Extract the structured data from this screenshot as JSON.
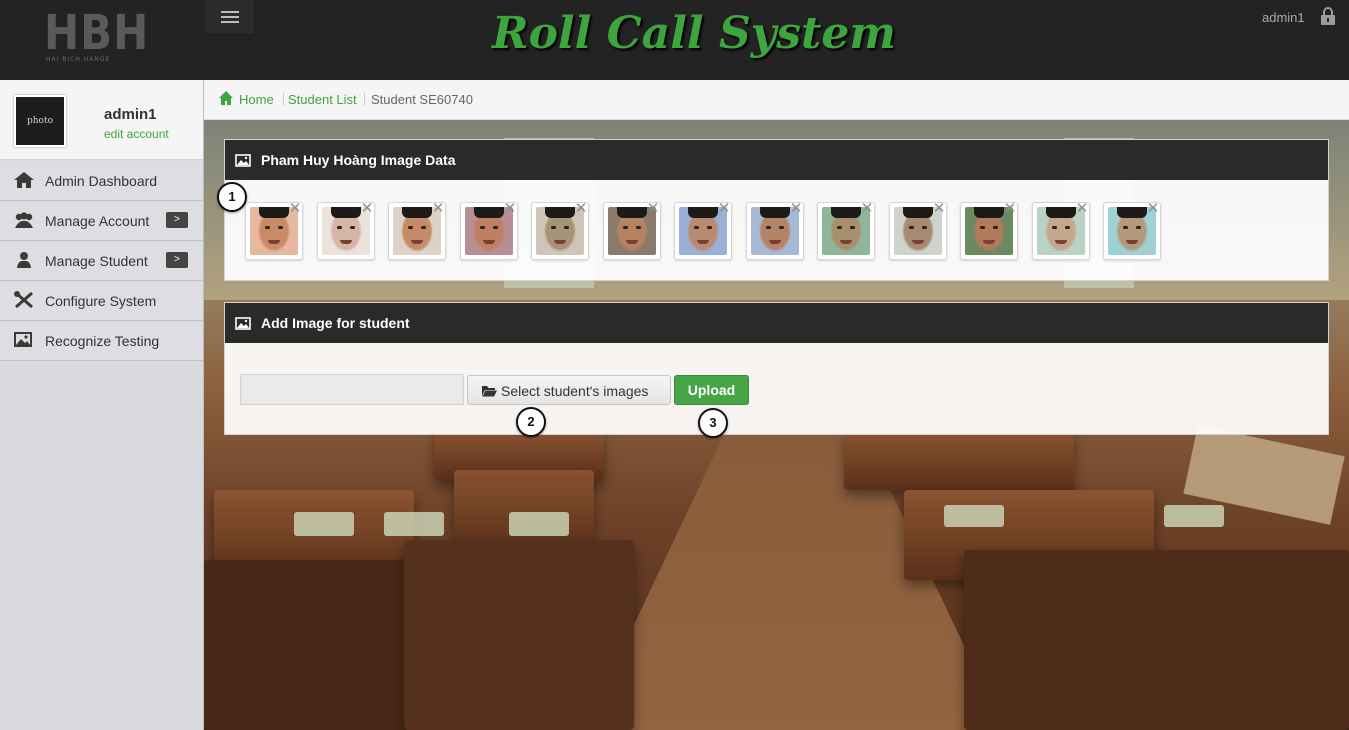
{
  "header": {
    "logo_text": "HBH",
    "logo_tagline": "HAI BICH HANGE",
    "app_title": "Roll Call System",
    "user": "admin1"
  },
  "sidebar": {
    "photo_label": "photo",
    "username": "admin1",
    "edit_account": "edit account",
    "items": [
      {
        "label": "Admin Dashboard",
        "icon": "home-icon",
        "arrow": ""
      },
      {
        "label": "Manage Account",
        "icon": "users-icon",
        "arrow": ">"
      },
      {
        "label": "Manage Student",
        "icon": "user-icon",
        "arrow": ">"
      },
      {
        "label": "Configure System",
        "icon": "tools-icon",
        "arrow": ""
      },
      {
        "label": "Recognize Testing",
        "icon": "image-icon",
        "arrow": ""
      }
    ]
  },
  "breadcrumb": {
    "home": "Home",
    "student_list": "Student List",
    "current": "Student SE60740"
  },
  "image_panel": {
    "title": "Pham Huy Hoàng Image Data",
    "remove_glyph": "✕",
    "thumbnails": [
      {
        "skin": "#c98a66",
        "bg": "#e6b8a0"
      },
      {
        "skin": "#d6b4a6",
        "bg": "#ece2dc"
      },
      {
        "skin": "#c58b68",
        "bg": "#dcd2c6"
      },
      {
        "skin": "#bf7f62",
        "bg": "#b88e94"
      },
      {
        "skin": "#a9927a",
        "bg": "#cdc6b8"
      },
      {
        "skin": "#b58262",
        "bg": "#8a7a6c"
      },
      {
        "skin": "#b98a72",
        "bg": "#9ab0d6"
      },
      {
        "skin": "#b48468",
        "bg": "#a6b8d4"
      },
      {
        "skin": "#a8906e",
        "bg": "#8fb69a"
      },
      {
        "skin": "#a88a70",
        "bg": "#cfd3cd"
      },
      {
        "skin": "#b07a5c",
        "bg": "#6a8a62"
      },
      {
        "skin": "#c3a88e",
        "bg": "#b9d2c2"
      },
      {
        "skin": "#b3987c",
        "bg": "#9fd0d4"
      }
    ]
  },
  "upload_panel": {
    "title": "Add Image for student",
    "select_button": "Select student's images",
    "upload_button": "Upload"
  },
  "callouts": [
    "1",
    "2",
    "3"
  ],
  "colors": {
    "accent_green": "#3da53d",
    "upload_green": "#47a447",
    "panel_header": "#2c2a28",
    "topbar": "#232323"
  }
}
